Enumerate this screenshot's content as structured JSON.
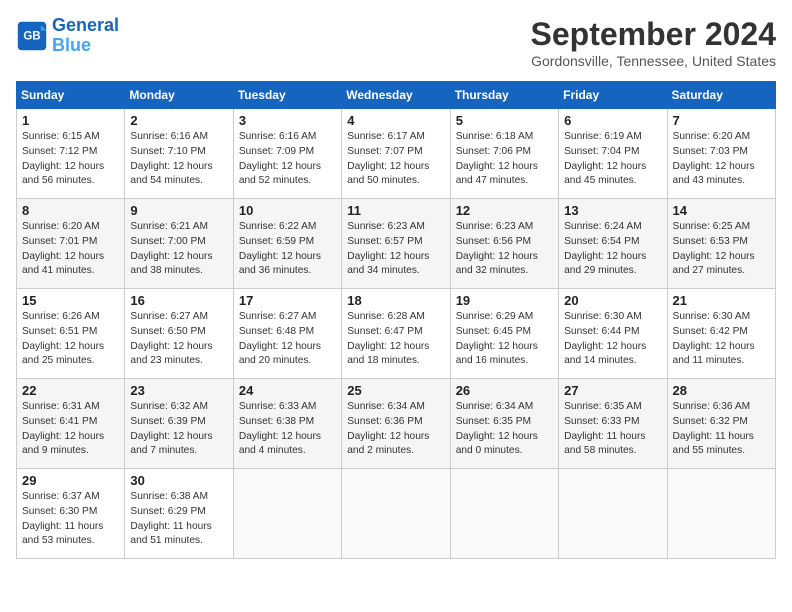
{
  "header": {
    "logo_line1": "General",
    "logo_line2": "Blue",
    "month": "September 2024",
    "location": "Gordonsville, Tennessee, United States"
  },
  "weekdays": [
    "Sunday",
    "Monday",
    "Tuesday",
    "Wednesday",
    "Thursday",
    "Friday",
    "Saturday"
  ],
  "weeks": [
    [
      {
        "day": "1",
        "rise": "6:15 AM",
        "set": "7:12 PM",
        "daylight": "12 hours and 56 minutes."
      },
      {
        "day": "2",
        "rise": "6:16 AM",
        "set": "7:10 PM",
        "daylight": "12 hours and 54 minutes."
      },
      {
        "day": "3",
        "rise": "6:16 AM",
        "set": "7:09 PM",
        "daylight": "12 hours and 52 minutes."
      },
      {
        "day": "4",
        "rise": "6:17 AM",
        "set": "7:07 PM",
        "daylight": "12 hours and 50 minutes."
      },
      {
        "day": "5",
        "rise": "6:18 AM",
        "set": "7:06 PM",
        "daylight": "12 hours and 47 minutes."
      },
      {
        "day": "6",
        "rise": "6:19 AM",
        "set": "7:04 PM",
        "daylight": "12 hours and 45 minutes."
      },
      {
        "day": "7",
        "rise": "6:20 AM",
        "set": "7:03 PM",
        "daylight": "12 hours and 43 minutes."
      }
    ],
    [
      {
        "day": "8",
        "rise": "6:20 AM",
        "set": "7:01 PM",
        "daylight": "12 hours and 41 minutes."
      },
      {
        "day": "9",
        "rise": "6:21 AM",
        "set": "7:00 PM",
        "daylight": "12 hours and 38 minutes."
      },
      {
        "day": "10",
        "rise": "6:22 AM",
        "set": "6:59 PM",
        "daylight": "12 hours and 36 minutes."
      },
      {
        "day": "11",
        "rise": "6:23 AM",
        "set": "6:57 PM",
        "daylight": "12 hours and 34 minutes."
      },
      {
        "day": "12",
        "rise": "6:23 AM",
        "set": "6:56 PM",
        "daylight": "12 hours and 32 minutes."
      },
      {
        "day": "13",
        "rise": "6:24 AM",
        "set": "6:54 PM",
        "daylight": "12 hours and 29 minutes."
      },
      {
        "day": "14",
        "rise": "6:25 AM",
        "set": "6:53 PM",
        "daylight": "12 hours and 27 minutes."
      }
    ],
    [
      {
        "day": "15",
        "rise": "6:26 AM",
        "set": "6:51 PM",
        "daylight": "12 hours and 25 minutes."
      },
      {
        "day": "16",
        "rise": "6:27 AM",
        "set": "6:50 PM",
        "daylight": "12 hours and 23 minutes."
      },
      {
        "day": "17",
        "rise": "6:27 AM",
        "set": "6:48 PM",
        "daylight": "12 hours and 20 minutes."
      },
      {
        "day": "18",
        "rise": "6:28 AM",
        "set": "6:47 PM",
        "daylight": "12 hours and 18 minutes."
      },
      {
        "day": "19",
        "rise": "6:29 AM",
        "set": "6:45 PM",
        "daylight": "12 hours and 16 minutes."
      },
      {
        "day": "20",
        "rise": "6:30 AM",
        "set": "6:44 PM",
        "daylight": "12 hours and 14 minutes."
      },
      {
        "day": "21",
        "rise": "6:30 AM",
        "set": "6:42 PM",
        "daylight": "12 hours and 11 minutes."
      }
    ],
    [
      {
        "day": "22",
        "rise": "6:31 AM",
        "set": "6:41 PM",
        "daylight": "12 hours and 9 minutes."
      },
      {
        "day": "23",
        "rise": "6:32 AM",
        "set": "6:39 PM",
        "daylight": "12 hours and 7 minutes."
      },
      {
        "day": "24",
        "rise": "6:33 AM",
        "set": "6:38 PM",
        "daylight": "12 hours and 4 minutes."
      },
      {
        "day": "25",
        "rise": "6:34 AM",
        "set": "6:36 PM",
        "daylight": "12 hours and 2 minutes."
      },
      {
        "day": "26",
        "rise": "6:34 AM",
        "set": "6:35 PM",
        "daylight": "12 hours and 0 minutes."
      },
      {
        "day": "27",
        "rise": "6:35 AM",
        "set": "6:33 PM",
        "daylight": "11 hours and 58 minutes."
      },
      {
        "day": "28",
        "rise": "6:36 AM",
        "set": "6:32 PM",
        "daylight": "11 hours and 55 minutes."
      }
    ],
    [
      {
        "day": "29",
        "rise": "6:37 AM",
        "set": "6:30 PM",
        "daylight": "11 hours and 53 minutes."
      },
      {
        "day": "30",
        "rise": "6:38 AM",
        "set": "6:29 PM",
        "daylight": "11 hours and 51 minutes."
      },
      null,
      null,
      null,
      null,
      null
    ]
  ]
}
